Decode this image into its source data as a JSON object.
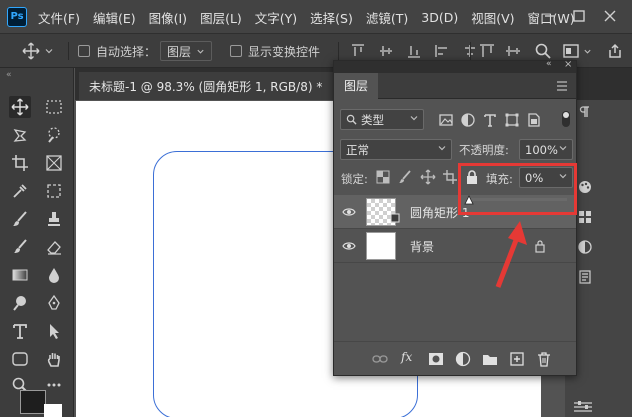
{
  "app": {
    "logo": "Ps"
  },
  "menu": [
    "文件(F)",
    "编辑(E)",
    "图像(I)",
    "图层(L)",
    "文字(Y)",
    "选择(S)",
    "滤镜(T)",
    "3D(D)",
    "视图(V)",
    "窗口(W)"
  ],
  "options": {
    "auto_select_label": "自动选择：",
    "auto_select_value": "图层",
    "show_transform_label": "显示变换控件"
  },
  "document": {
    "tab_title": "未标题-1 @ 98.3% (圆角矩形 1, RGB/8) *",
    "close": "×"
  },
  "layers_panel": {
    "title": "图层",
    "filter_kind": "类型",
    "blend_mode": "正常",
    "opacity_label": "不透明度:",
    "opacity_value": "100%",
    "lock_label": "锁定:",
    "fill_label": "填充:",
    "fill_value": "0%",
    "fill_level": 0,
    "layers": [
      {
        "name": "圆角矩形 1",
        "visible": true,
        "selected": true,
        "locked": false,
        "transparent": true
      },
      {
        "name": "背景",
        "visible": true,
        "selected": false,
        "locked": true,
        "transparent": false
      }
    ],
    "footer_icons": [
      "link-icon",
      "fx-icon",
      "mask-icon",
      "adjustment-icon",
      "group-folder-icon",
      "new-layer-icon",
      "trash-icon"
    ]
  },
  "annotation": {
    "color": "#e53935"
  },
  "colors": {
    "shape_stroke": "#3b6fd6",
    "ps_blue": "#31a8ff"
  }
}
